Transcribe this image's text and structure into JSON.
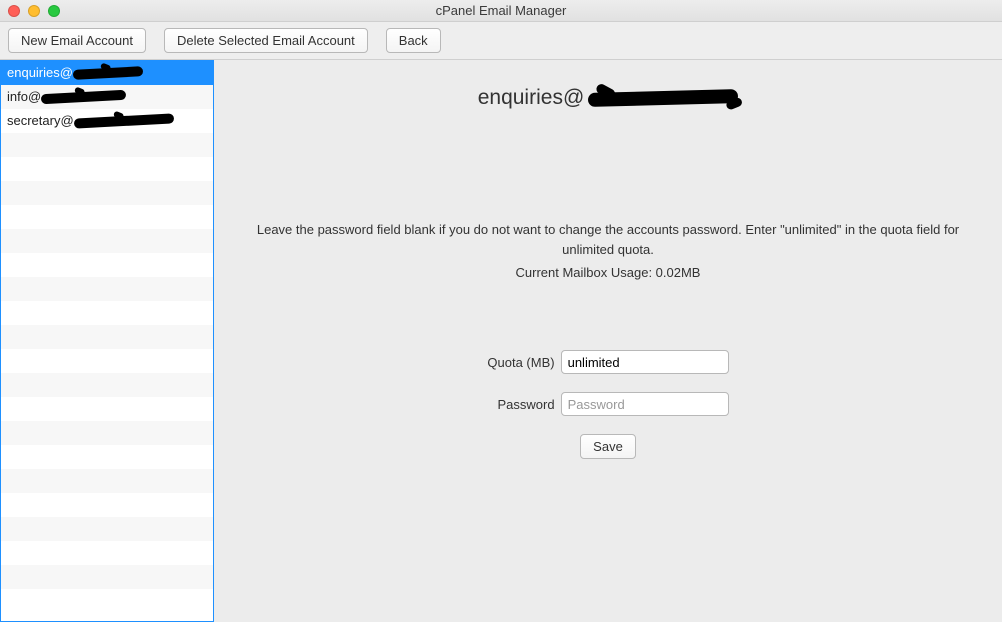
{
  "window": {
    "title": "cPanel Email Manager"
  },
  "toolbar": {
    "new_account": "New Email Account",
    "delete_account": "Delete Selected Email Account",
    "back": "Back"
  },
  "sidebar": {
    "items": [
      {
        "prefix": "enquiries@",
        "selected": true
      },
      {
        "prefix": "info@",
        "selected": false
      },
      {
        "prefix": "secretary@",
        "selected": false
      }
    ]
  },
  "main": {
    "heading_prefix": "enquiries@",
    "instructions": "Leave the password field blank if you do not want to change the accounts password. Enter \"unlimited\" in the quota field for unlimited quota.",
    "usage_label": "Current Mailbox Usage: ",
    "usage_value": "0.02MB",
    "quota_label": "Quota (MB)",
    "quota_value": "unlimited",
    "password_label": "Password",
    "password_placeholder": "Password",
    "save_label": "Save"
  }
}
